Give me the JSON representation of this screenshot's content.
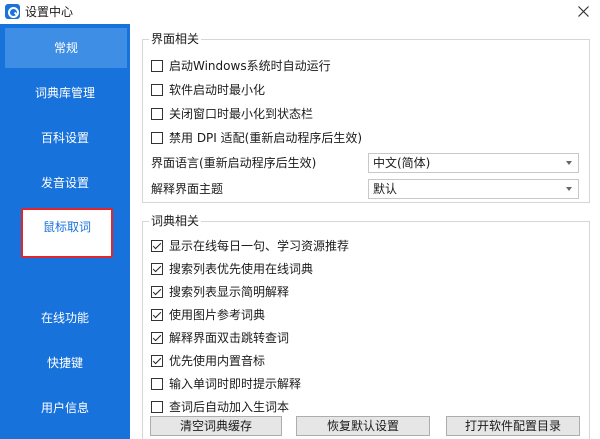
{
  "window": {
    "title": "设置中心"
  },
  "sidebar": {
    "items": [
      {
        "label": "常规",
        "active": true
      },
      {
        "label": "词典库管理"
      },
      {
        "label": "百科设置"
      },
      {
        "label": "发音设置"
      },
      {
        "label": "鼠标取词"
      },
      {
        "label": "在线功能"
      },
      {
        "label": "快捷键"
      },
      {
        "label": "用户信息"
      }
    ]
  },
  "interface_group": {
    "title": "界面相关",
    "options": [
      {
        "label": "启动Windows系统时自动运行",
        "checked": false
      },
      {
        "label": "软件启动时最小化",
        "checked": false
      },
      {
        "label": "关闭窗口时最小化到状态栏",
        "checked": false
      },
      {
        "label": "禁用 DPI 适配(重新启动程序后生效)",
        "checked": false
      }
    ],
    "language_label": "界面语言(重新启动程序后生效)",
    "language_value": "中文(简体)",
    "theme_label": "解释界面主题",
    "theme_value": "默认"
  },
  "dictionary_group": {
    "title": "词典相关",
    "options": [
      {
        "label": "显示在线每日一句、学习资源推荐",
        "checked": true
      },
      {
        "label": "搜索列表优先使用在线词典",
        "checked": true
      },
      {
        "label": "搜索列表显示简明解释",
        "checked": true
      },
      {
        "label": "使用图片参考词典",
        "checked": true
      },
      {
        "label": "解释界面双击跳转查词",
        "checked": true
      },
      {
        "label": "优先使用内置音标",
        "checked": true
      },
      {
        "label": "输入单词时即时提示解释",
        "checked": false
      },
      {
        "label": "查词后自动加入生词本",
        "checked": false
      }
    ]
  },
  "buttons": {
    "clear_cache": "清空词典缓存",
    "restore_defaults": "恢复默认设置",
    "open_config_dir": "打开软件配置目录"
  }
}
